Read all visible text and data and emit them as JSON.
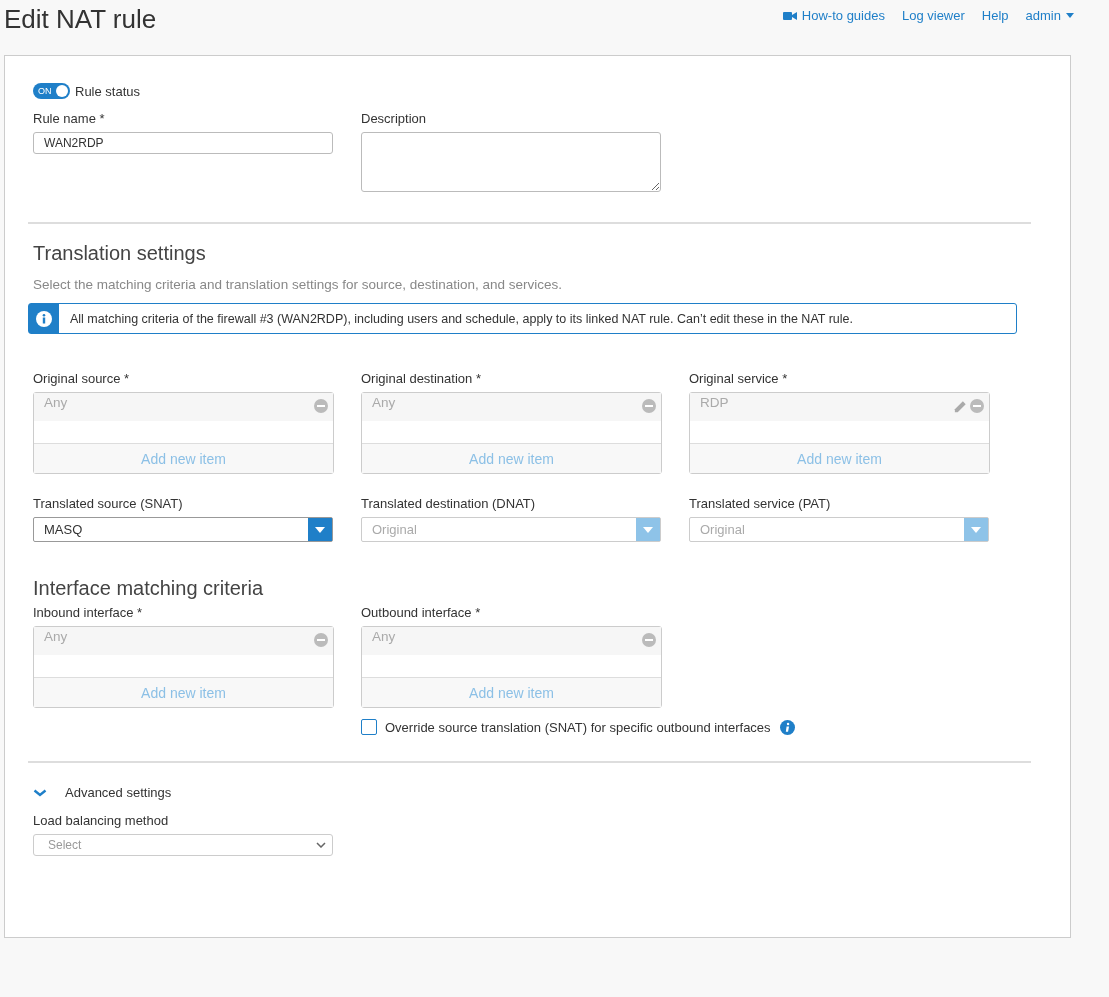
{
  "header": {
    "title": "Edit NAT rule",
    "links": [
      {
        "label": "How-to guides",
        "kind": "video"
      },
      {
        "label": "Log viewer",
        "kind": "plain"
      },
      {
        "label": "Help",
        "kind": "plain"
      },
      {
        "label": "admin",
        "kind": "menu"
      }
    ]
  },
  "rule_status": {
    "on": true,
    "toggle_text": "ON",
    "label": "Rule status"
  },
  "rule_name": {
    "label": "Rule name *",
    "value": "WAN2RDP"
  },
  "description": {
    "label": "Description"
  },
  "translation": {
    "heading": "Translation settings",
    "subtitle": "Select the matching criteria and translation settings for source, destination, and services.",
    "info": "All matching criteria of the firewall #3 (WAN2RDP), including users and schedule, apply to its linked NAT rule. Can’t edit these in the NAT rule."
  },
  "original": [
    {
      "label": "Original source *",
      "item": "Any",
      "editable": false,
      "add": "Add new item"
    },
    {
      "label": "Original destination *",
      "item": "Any",
      "editable": false,
      "add": "Add new item"
    },
    {
      "label": "Original service *",
      "item": "RDP",
      "editable": true,
      "add": "Add new item"
    }
  ],
  "translated": [
    {
      "label": "Translated source (SNAT)",
      "value": "MASQ",
      "disabled": false
    },
    {
      "label": "Translated destination (DNAT)",
      "value": "Original",
      "disabled": true
    },
    {
      "label": "Translated service (PAT)",
      "value": "Original",
      "disabled": true
    }
  ],
  "interface": {
    "heading": "Interface matching criteria",
    "lists": [
      {
        "label": "Inbound interface *",
        "item": "Any",
        "add": "Add new item"
      },
      {
        "label": "Outbound interface *",
        "item": "Any",
        "add": "Add new item"
      }
    ],
    "override": {
      "label": "Override source translation (SNAT) for specific outbound interfaces",
      "checked": false
    }
  },
  "advanced": {
    "label": "Advanced settings",
    "expanded": true,
    "load_balancing": {
      "label": "Load balancing method",
      "placeholder": "Select"
    }
  }
}
